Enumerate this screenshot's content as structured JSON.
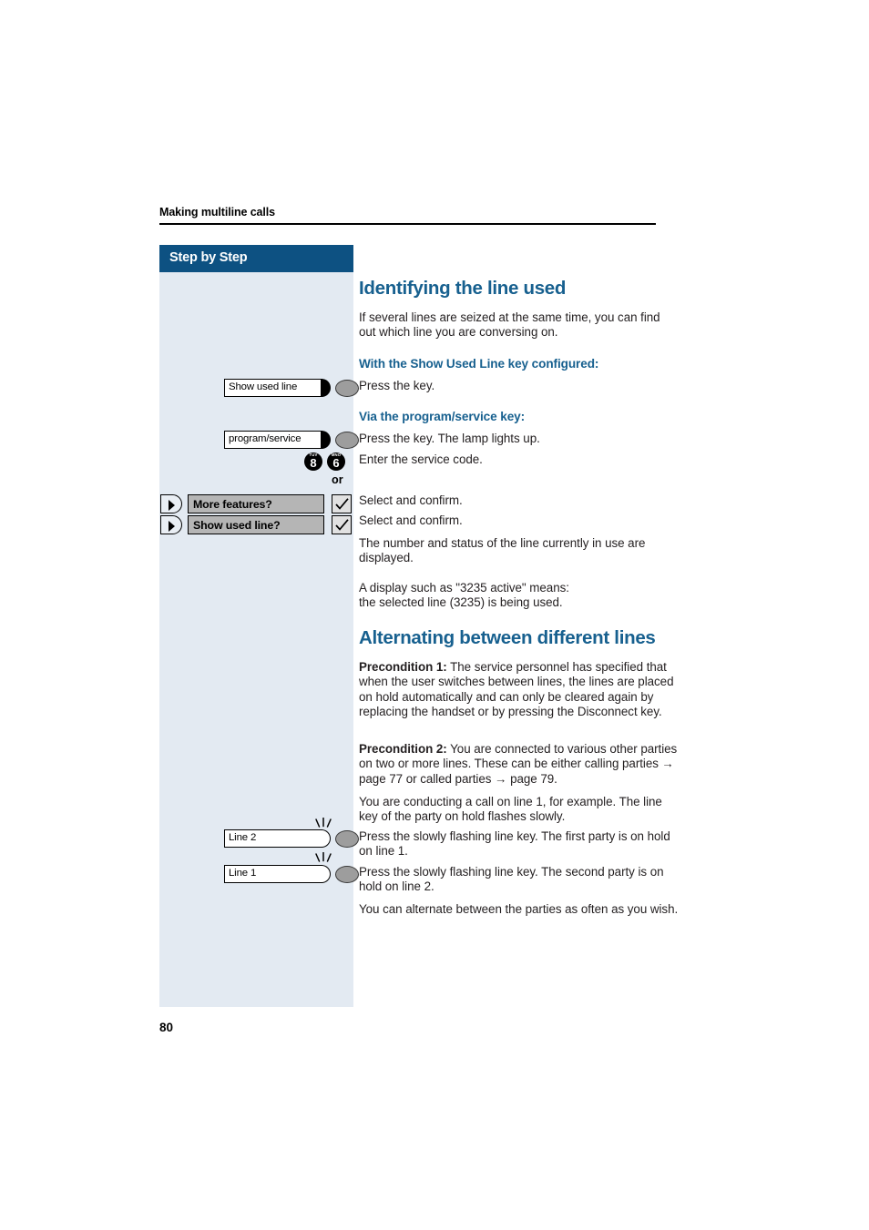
{
  "document": {
    "running_head": "Making multiline calls",
    "page_number": "80"
  },
  "sidebar": {
    "banner_label": "Step by Step",
    "keys": [
      {
        "id": "show-used-line",
        "label": "Show used line",
        "led": "solid",
        "flashing": false
      },
      {
        "id": "program-service",
        "label": "program/service",
        "led": "solid",
        "flashing": false
      },
      {
        "id": "line-2",
        "label": "Line 2",
        "led": "hollow",
        "flashing": true
      },
      {
        "id": "line-1",
        "label": "Line 1",
        "led": "hollow",
        "flashing": true
      }
    ],
    "digit_keys": [
      {
        "digit": "8",
        "letters": "TUV"
      },
      {
        "digit": "6",
        "letters": "MNO"
      }
    ],
    "or_label": "or",
    "options": [
      {
        "id": "more-features",
        "label": "More features?"
      },
      {
        "id": "show-used-line-option",
        "label": "Show used line?"
      }
    ],
    "icons": {
      "scroll_key": "scroll-right-icon",
      "confirm_box": "checkmark-icon",
      "flash_rays": "flashing-lamp-icon"
    }
  },
  "content": {
    "heading_1": "Identifying the line used",
    "intro": "If several lines are seized at the same time, you can find out which line you are conversing on.",
    "subheading_1": "With the Show Used Line key configured:",
    "step_press_key": "Press the key.",
    "subheading_2": "Via the program/service key:",
    "step_press_key_lamp": "Press the key. The lamp lights up.",
    "step_enter_code": "Enter the service code.",
    "step_select_confirm_1": "Select and confirm.",
    "step_select_confirm_2": "Select and confirm.",
    "para_number_status": "The number and status of the line currently in use are displayed.",
    "para_display_example_line1": "A display such as \"3235 active\" means:",
    "para_display_example_line2": "the selected line (3235) is being used.",
    "heading_2": "Alternating between different lines",
    "precondition_1_label": "Precondition 1:",
    "precondition_1_text": " The service personnel has specified that when the user switches between lines, the lines are placed on hold automatically and can only be cleared again by replacing the handset or by pressing the Disconnect key.",
    "precondition_2_label": "Precondition 2:",
    "precondition_2_text_a": " You are connected to various other parties on two or more lines. These can be either calling parties ",
    "precondition_2_arrow_1": "→",
    "precondition_2_text_b": " page 77 or called parties ",
    "precondition_2_arrow_2": "→",
    "precondition_2_text_c": " page 79.",
    "para_conducting": "You are conducting a call on line 1, for example. The line key of the party on hold flashes slowly.",
    "para_press_line2": "Press the slowly flashing line key. The first party is on hold on line 1.",
    "para_press_line1": "Press the slowly flashing line key. The second party is on hold on line 2.",
    "para_alternate": "You can alternate between the parties as often as you wish."
  },
  "colors": {
    "banner_blue": "#0d5182",
    "heading_blue": "#17608f",
    "sidebar_fill": "#e3eaf2",
    "key_gray": "#9d9d9d",
    "option_gray": "#b5b5b5"
  }
}
